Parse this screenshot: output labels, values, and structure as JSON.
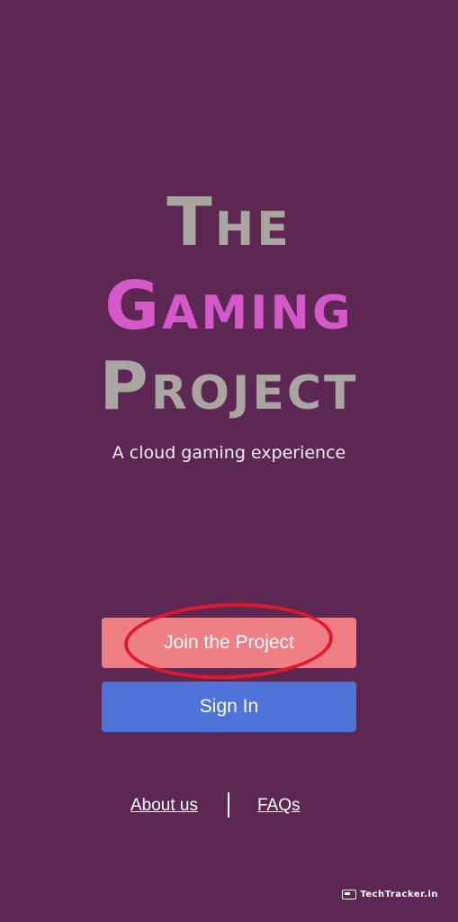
{
  "colors": {
    "background": "#5c2752",
    "logo_grey": "#a9a6a1",
    "logo_pink": "#d458c8",
    "join_button": "#ef7f84",
    "signin_button": "#4e74d9",
    "annotation_ring": "#e0192a"
  },
  "logo": {
    "line1": "The",
    "line2": "Gaming",
    "line3": "Project"
  },
  "tagline": "A cloud gaming experience",
  "buttons": {
    "join_label": "Join the Project",
    "signin_label": "Sign In"
  },
  "footer": {
    "about_label": "About us",
    "faqs_label": "FAQs"
  },
  "watermark": {
    "text": "TechTracker.in",
    "icon": "browser-window-icon"
  }
}
